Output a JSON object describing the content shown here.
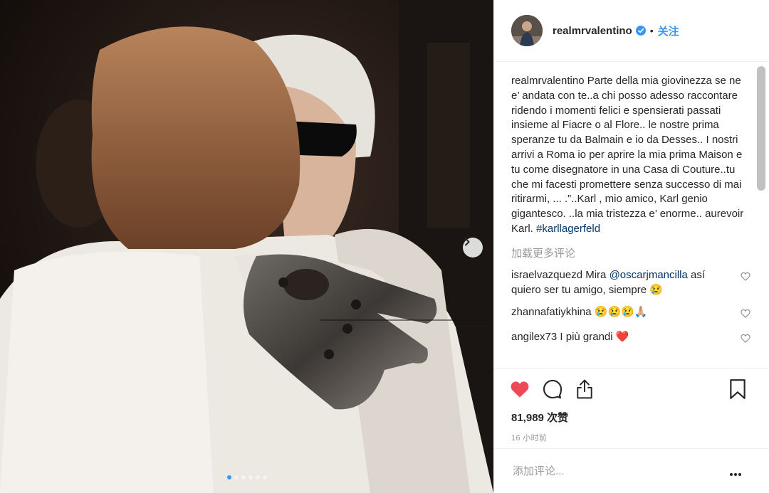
{
  "header": {
    "username": "realmrvalentino",
    "separator": "•",
    "follow_label": "关注"
  },
  "caption": {
    "username": "realmrvalentino",
    "text": "Parte della mia giovinezza se ne e’ andata con te..a chi posso adesso raccontare ridendo i momenti felici e spensierati passati insieme al Fiacre o al Flore.. le nostre prima speranze tu da Balmain e io da Desses.. I nostri arrivi a Roma io per aprire la mia prima Maison e tu come disegnatore in una Casa di Couture..tu che mi facesti promettere senza successo di mai ritirarmi, ... .”..Karl , mio amico, Karl genio gigantesco. ..la mia tristezza e’ enorme.. aurevoir Karl.",
    "hashtag": "#karllagerfeld"
  },
  "load_more_label": "加载更多评论",
  "comments": [
    {
      "username": "israelvazquezd",
      "text_before": "Mira ",
      "mention": "@oscarjmancilla",
      "text_after": " así quiero ser tu amigo, siempre 😢"
    },
    {
      "username": "zhannafatiykhina",
      "text_before": "😢😢😢🙏🏼",
      "mention": "",
      "text_after": ""
    },
    {
      "username": "angilex73",
      "text_before": "I più grandi ❤️",
      "mention": "",
      "text_after": ""
    }
  ],
  "likes_label": "81,989 次赞",
  "timestamp": "16 小时前",
  "add_comment_placeholder": "添加评论...",
  "carousel": {
    "count": 6,
    "active_index": 0
  },
  "colors": {
    "accent": "#3897f0",
    "like_red": "#ed4956",
    "hashtag": "#003569",
    "muted": "#999999"
  },
  "icons": [
    "verified-badge-icon",
    "chevron-right-icon",
    "heart-icon",
    "comment-icon",
    "share-icon",
    "bookmark-icon",
    "more-options-icon"
  ]
}
